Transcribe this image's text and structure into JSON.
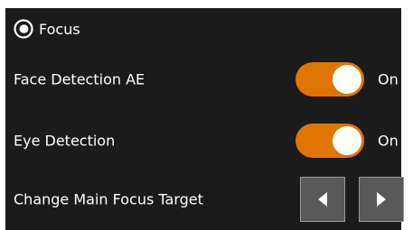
{
  "section": {
    "title": "Focus",
    "icon": "focus-ring-icon"
  },
  "settings": [
    {
      "label": "Face Detection AE",
      "type": "toggle",
      "state": "On",
      "enabled": true
    },
    {
      "label": "Eye Detection",
      "type": "toggle",
      "state": "On",
      "enabled": true
    },
    {
      "label": "Change Main Focus Target",
      "type": "arrows",
      "icons": [
        "arrow-left-icon",
        "arrow-right-icon"
      ]
    }
  ],
  "colors": {
    "panel_background": "#1b1b1b",
    "toggle_on": "#e07600",
    "arrow_button": "#595959",
    "text": "#ffffff"
  }
}
